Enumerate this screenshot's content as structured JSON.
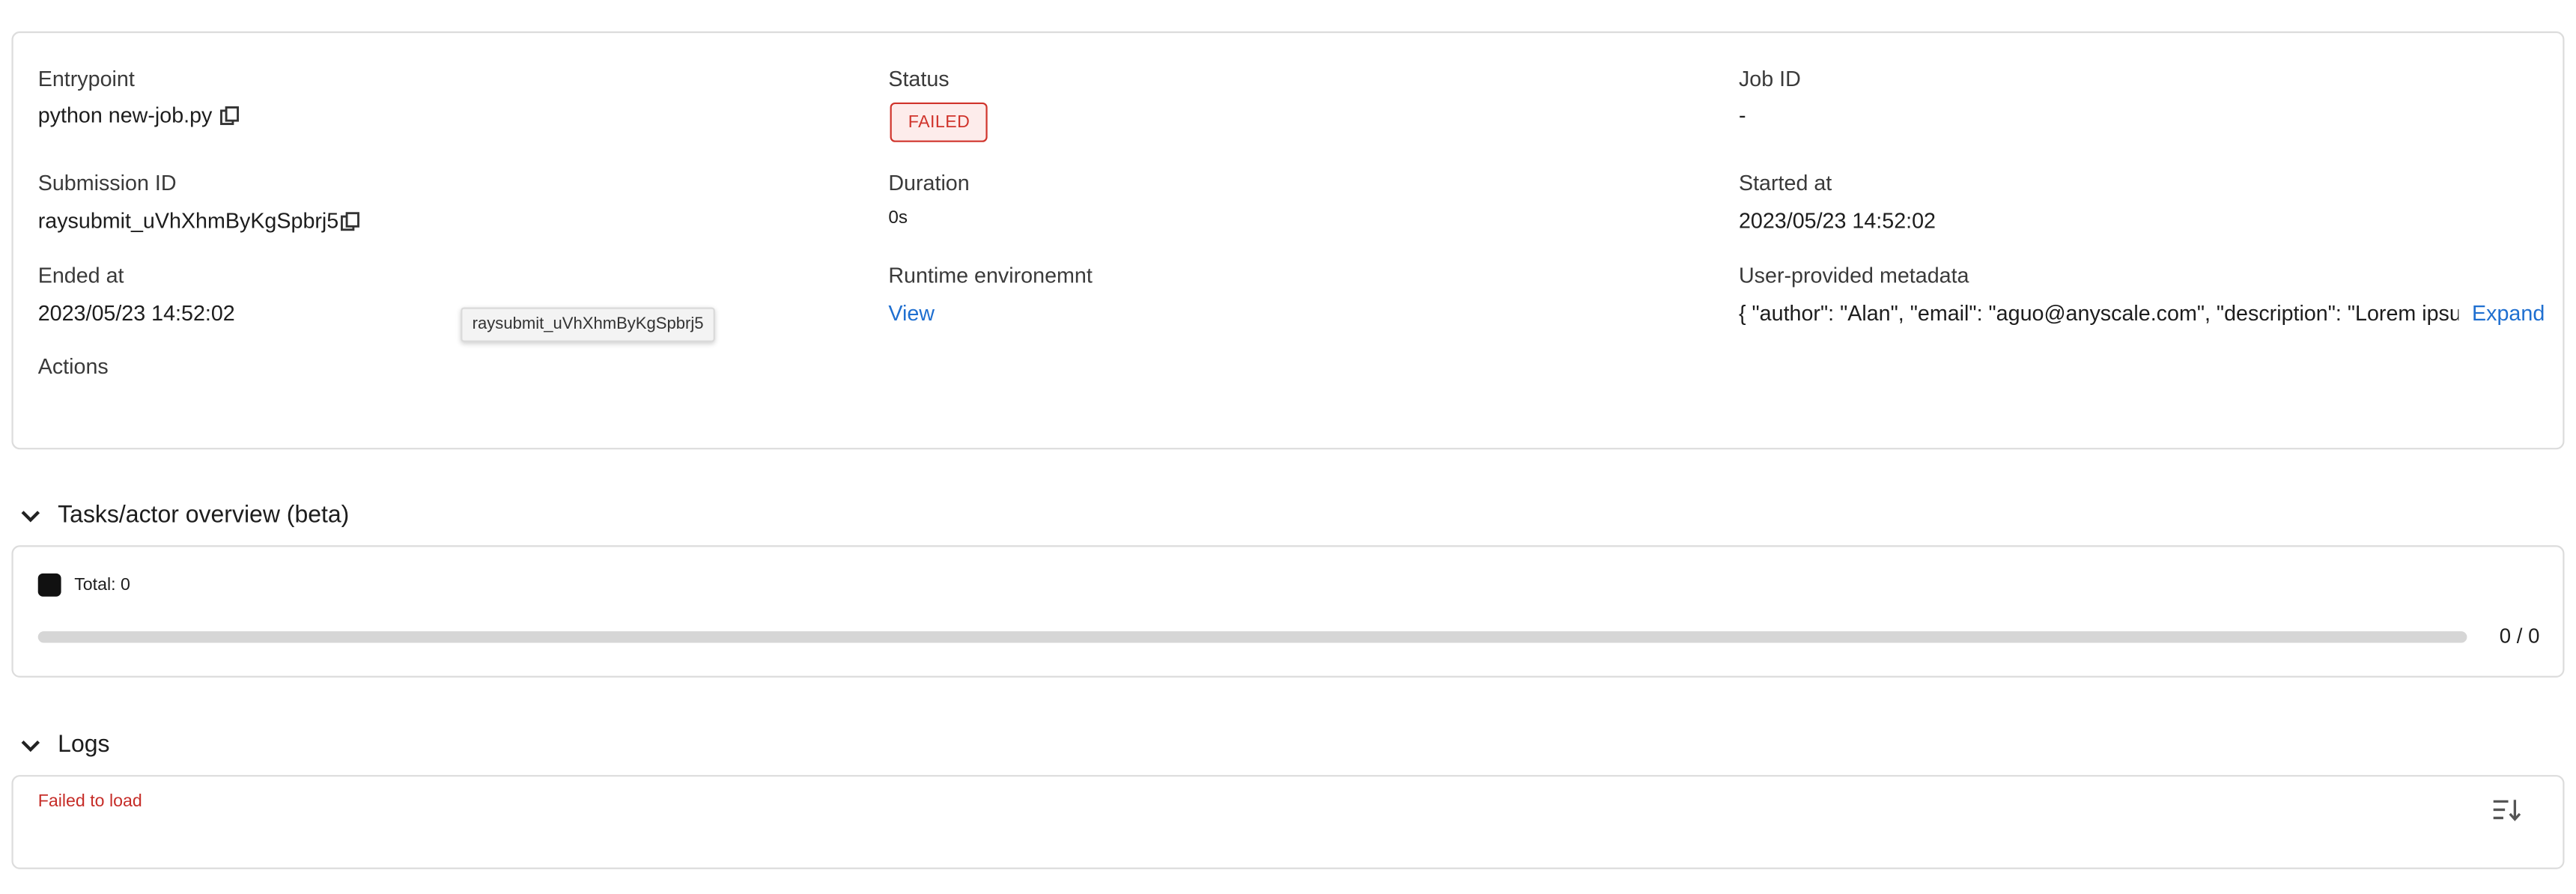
{
  "details": {
    "entrypoint": {
      "label": "Entrypoint",
      "value": "python new-job.py"
    },
    "status": {
      "label": "Status",
      "value": "FAILED"
    },
    "job_id": {
      "label": "Job ID",
      "value": "-"
    },
    "submission_id": {
      "label": "Submission ID",
      "value": "raysubmit_uVhXhmByKgSpbrj5"
    },
    "duration": {
      "label": "Duration",
      "value": "0s"
    },
    "started_at": {
      "label": "Started at",
      "value": "2023/05/23 14:52:02"
    },
    "ended_at": {
      "label": "Ended at",
      "value": "2023/05/23 14:52:02"
    },
    "runtime_env": {
      "label": "Runtime environemnt",
      "link": "View"
    },
    "metadata": {
      "label": "User-provided metadata",
      "value": "{ \"author\": \"Alan\", \"email\": \"aguo@anyscale.com\", \"description\": \"Lorem ipsum…",
      "expand": "Expand"
    },
    "actions": {
      "label": "Actions"
    },
    "tooltip": "raysubmit_uVhXhmByKgSpbrj5"
  },
  "tasks_overview": {
    "title": "Tasks/actor overview (beta)",
    "legend": "Total: 0",
    "progress": {
      "finished": 0,
      "total": 0,
      "label": "0 / 0"
    }
  },
  "logs": {
    "title": "Logs",
    "error": "Failed to load"
  },
  "colors": {
    "failed": "#d0342c",
    "link": "#1f6fd0",
    "border": "#dcdcdc"
  }
}
